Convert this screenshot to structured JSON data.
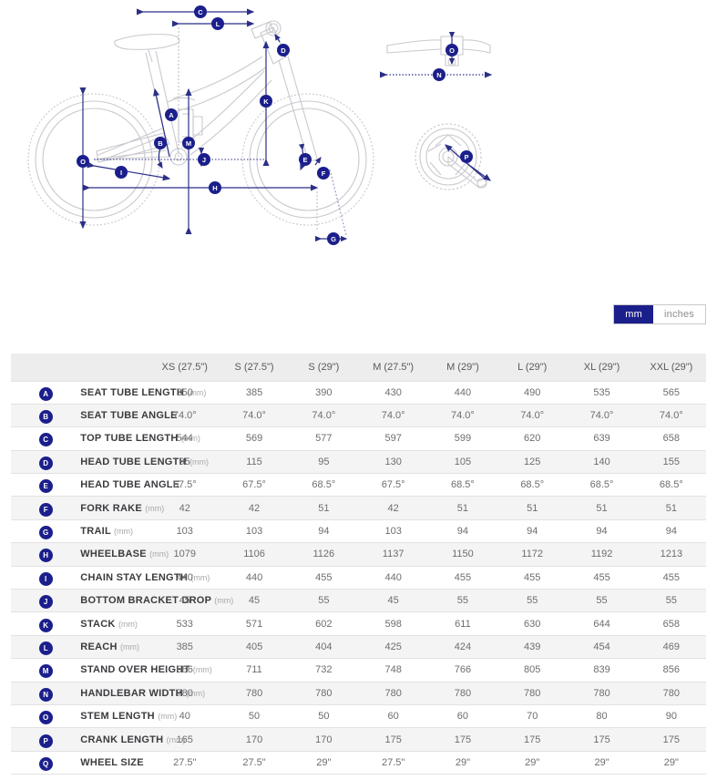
{
  "unit_toggle": {
    "options": [
      {
        "label": "mm",
        "active": true
      },
      {
        "label": "inches",
        "active": false
      }
    ]
  },
  "diagram": {
    "accent_color": "#2b2f87",
    "frame_color": "#c9c9cf",
    "side_view_labels": [
      "C",
      "L",
      "D",
      "A",
      "K",
      "B",
      "M",
      "J",
      "E",
      "F",
      "O",
      "I",
      "H",
      "G"
    ],
    "handlebar_view_labels": [
      "O",
      "N"
    ],
    "crank_view_labels": [
      "P"
    ]
  },
  "table": {
    "header_blank_badge": "",
    "header_blank_name": "",
    "columns": [
      "XS (27.5\")",
      "S (27.5\")",
      "S (29\")",
      "M (27.5\")",
      "M (29\")",
      "L (29\")",
      "XL (29\")",
      "XXL (29\")"
    ],
    "rows": [
      {
        "badge": "A",
        "label": "SEAT TUBE LENGTH",
        "unit": "(mm)",
        "values": [
          "350",
          "385",
          "390",
          "430",
          "440",
          "490",
          "535",
          "565"
        ]
      },
      {
        "badge": "B",
        "label": "SEAT TUBE ANGLE",
        "unit": "",
        "values": [
          "74.0°",
          "74.0°",
          "74.0°",
          "74.0°",
          "74.0°",
          "74.0°",
          "74.0°",
          "74.0°"
        ]
      },
      {
        "badge": "C",
        "label": "TOP TUBE LENGTH",
        "unit": "(mm)",
        "values": [
          "544",
          "569",
          "577",
          "597",
          "599",
          "620",
          "639",
          "658"
        ]
      },
      {
        "badge": "D",
        "label": "HEAD TUBE LENGTH",
        "unit": "(mm)",
        "values": [
          "95",
          "115",
          "95",
          "130",
          "105",
          "125",
          "140",
          "155"
        ]
      },
      {
        "badge": "E",
        "label": "HEAD TUBE ANGLE",
        "unit": "",
        "values": [
          "67.5°",
          "67.5°",
          "68.5°",
          "67.5°",
          "68.5°",
          "68.5°",
          "68.5°",
          "68.5°"
        ]
      },
      {
        "badge": "F",
        "label": "FORK RAKE",
        "unit": "(mm)",
        "values": [
          "42",
          "42",
          "51",
          "42",
          "51",
          "51",
          "51",
          "51"
        ]
      },
      {
        "badge": "G",
        "label": "TRAIL",
        "unit": "(mm)",
        "values": [
          "103",
          "103",
          "94",
          "103",
          "94",
          "94",
          "94",
          "94"
        ]
      },
      {
        "badge": "H",
        "label": "WHEELBASE",
        "unit": "(mm)",
        "values": [
          "1079",
          "1106",
          "1126",
          "1137",
          "1150",
          "1172",
          "1192",
          "1213"
        ]
      },
      {
        "badge": "I",
        "label": "CHAIN STAY LENGTH",
        "unit": "(mm)",
        "values": [
          "440",
          "440",
          "455",
          "440",
          "455",
          "455",
          "455",
          "455"
        ]
      },
      {
        "badge": "J",
        "label": "BOTTOM BRACKET DROP",
        "unit": "(mm)",
        "values": [
          "45",
          "45",
          "55",
          "45",
          "55",
          "55",
          "55",
          "55"
        ]
      },
      {
        "badge": "K",
        "label": "STACK",
        "unit": "(mm)",
        "values": [
          "533",
          "571",
          "602",
          "598",
          "611",
          "630",
          "644",
          "658"
        ]
      },
      {
        "badge": "L",
        "label": "REACH",
        "unit": "(mm)",
        "values": [
          "385",
          "405",
          "404",
          "425",
          "424",
          "439",
          "454",
          "469"
        ]
      },
      {
        "badge": "M",
        "label": "STAND OVER HEIGHT",
        "unit": "(mm)",
        "values": [
          "686",
          "711",
          "732",
          "748",
          "766",
          "805",
          "839",
          "856"
        ]
      },
      {
        "badge": "N",
        "label": "HANDLEBAR WIDTH",
        "unit": "(mm)",
        "values": [
          "780",
          "780",
          "780",
          "780",
          "780",
          "780",
          "780",
          "780"
        ]
      },
      {
        "badge": "O",
        "label": "STEM LENGTH",
        "unit": "(mm)",
        "values": [
          "40",
          "50",
          "50",
          "60",
          "60",
          "70",
          "80",
          "90"
        ]
      },
      {
        "badge": "P",
        "label": "CRANK LENGTH",
        "unit": "(mm)",
        "values": [
          "165",
          "170",
          "170",
          "175",
          "175",
          "175",
          "175",
          "175"
        ]
      },
      {
        "badge": "Q",
        "label": "WHEEL SIZE",
        "unit": "",
        "values": [
          "27.5\"",
          "27.5\"",
          "29\"",
          "27.5\"",
          "29\"",
          "29\"",
          "29\"",
          "29\""
        ]
      }
    ]
  }
}
